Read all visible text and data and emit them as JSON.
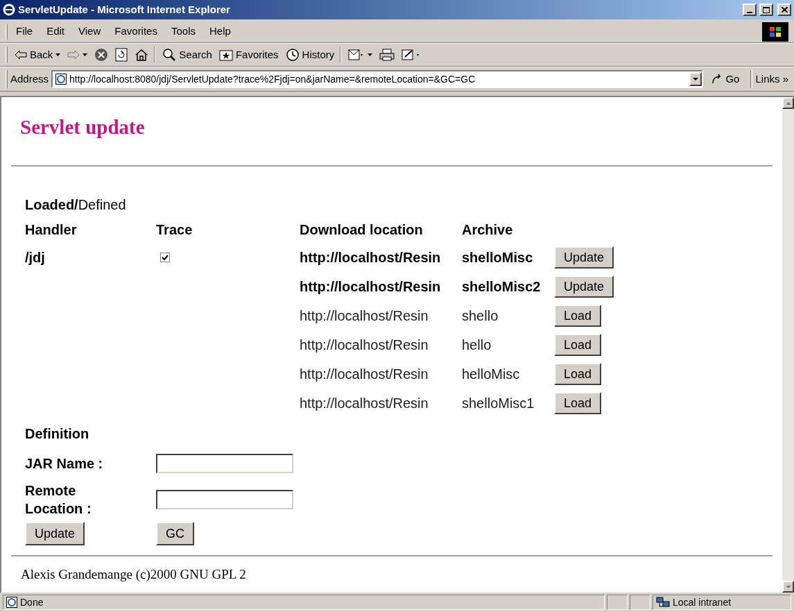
{
  "window": {
    "title": "ServletUpdate - Microsoft Internet Explorer"
  },
  "menu": [
    "File",
    "Edit",
    "View",
    "Favorites",
    "Tools",
    "Help"
  ],
  "toolbar": [
    {
      "kind": "back",
      "label": "Back"
    },
    {
      "kind": "forward"
    },
    {
      "kind": "stop"
    },
    {
      "kind": "refresh"
    },
    {
      "kind": "home"
    },
    {
      "kind": "search",
      "label": "Search"
    },
    {
      "kind": "favorites",
      "label": "Favorites"
    },
    {
      "kind": "history",
      "label": "History"
    },
    {
      "kind": "mail"
    },
    {
      "kind": "print"
    },
    {
      "kind": "edit"
    }
  ],
  "address": {
    "label": "Address",
    "value": "http://localhost:8080/jdj/ServletUpdate?trace%2Fjdj=on&jarName=&remoteLocation=&GC=GC",
    "go": "Go",
    "links": "Links »"
  },
  "page": {
    "title": "Servlet update",
    "section": "**Loaded/**Defined",
    "columns": [
      "Handler",
      "Trace",
      "Download location",
      "Archive"
    ],
    "handlers": [
      {
        "name": "/jdj",
        "trace": true
      }
    ],
    "rows": [
      {
        "location": "http://localhost/Resin",
        "archive": "shelloMisc",
        "loaded": true,
        "button": "Update"
      },
      {
        "location": "http://localhost/Resin",
        "archive": "shelloMisc2",
        "loaded": true,
        "button": "Update"
      },
      {
        "location": "http://localhost/Resin",
        "archive": "shello",
        "loaded": false,
        "button": "Load"
      },
      {
        "location": "http://localhost/Resin",
        "archive": "hello",
        "loaded": false,
        "button": "Load"
      },
      {
        "location": "http://localhost/Resin",
        "archive": "helloMisc",
        "loaded": false,
        "button": "Load"
      },
      {
        "location": "http://localhost/Resin",
        "archive": "shelloMisc1",
        "loaded": false,
        "button": "Load"
      }
    ],
    "definition": {
      "title": "Definition",
      "fields": [
        {
          "label": "JAR Name :"
        },
        {
          "label": "Remote Location :"
        }
      ],
      "buttons": [
        "Update",
        "GC"
      ]
    },
    "footer": "Alexis Grandemange (c)2000 GNU GPL 2"
  },
  "status_bar": {
    "text": "Done",
    "zone": "Local intranet"
  }
}
